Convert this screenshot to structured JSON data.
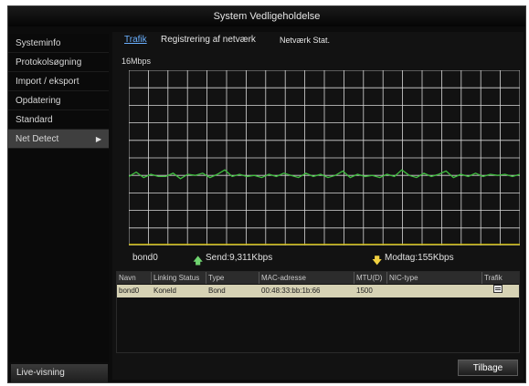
{
  "window": {
    "title": "System Vedligeholdelse"
  },
  "sidebar": {
    "items": [
      {
        "label": "Systeminfo"
      },
      {
        "label": "Protokolsøgning"
      },
      {
        "label": "Import / eksport"
      },
      {
        "label": "Opdatering"
      },
      {
        "label": "Standard"
      },
      {
        "label": "Net Detect",
        "active": true
      }
    ],
    "live_view": "Live-visning"
  },
  "tabs": [
    {
      "label": "Trafik",
      "active": true
    },
    {
      "label": "Registrering af netværk"
    },
    {
      "label": "Netværk Stat."
    }
  ],
  "graph": {
    "rate_label": "16Mbps",
    "send_color": "#3fbf3f",
    "recv_color": "#c8b400",
    "send_series": [
      6.3,
      6.7,
      6.2,
      6.5,
      6.3,
      6.3,
      6.6,
      6.1,
      6.5,
      6.4,
      6.6,
      6.2,
      6.5,
      6.9,
      6.3,
      6.5,
      6.3,
      6.4,
      6.2,
      6.5,
      6.3,
      6.6,
      6.4,
      6.2,
      6.6,
      6.3,
      6.5,
      6.2,
      6.4,
      6.8,
      6.2,
      6.5,
      6.3,
      6.4,
      6.2,
      6.5,
      6.3,
      6.9,
      6.4,
      6.2,
      6.6,
      6.3,
      6.5,
      6.8,
      6.2,
      6.5,
      6.3,
      6.6,
      6.3,
      6.5,
      6.4,
      6.5,
      6.3,
      6.5
    ],
    "recv_series": [
      0.1,
      0.1,
      0.1,
      0.1,
      0.1,
      0.1,
      0.1,
      0.1,
      0.1,
      0.1
    ]
  },
  "stats": {
    "interface": "bond0",
    "send": "Send:9,311Kbps",
    "receive": "Modtag:155Kbps"
  },
  "table": {
    "headers": [
      "Navn",
      "Linking Status",
      "Type",
      "MAC-adresse",
      "MTU(D)",
      "NIC-type",
      "Trafik"
    ],
    "rows": [
      {
        "name": "bond0",
        "status": "Koneld",
        "type": "Bond",
        "mac": "00:48:33:bb:1b:66",
        "mtu": "1500",
        "nic": ""
      }
    ]
  },
  "footer": {
    "back_label": "Tilbage"
  }
}
